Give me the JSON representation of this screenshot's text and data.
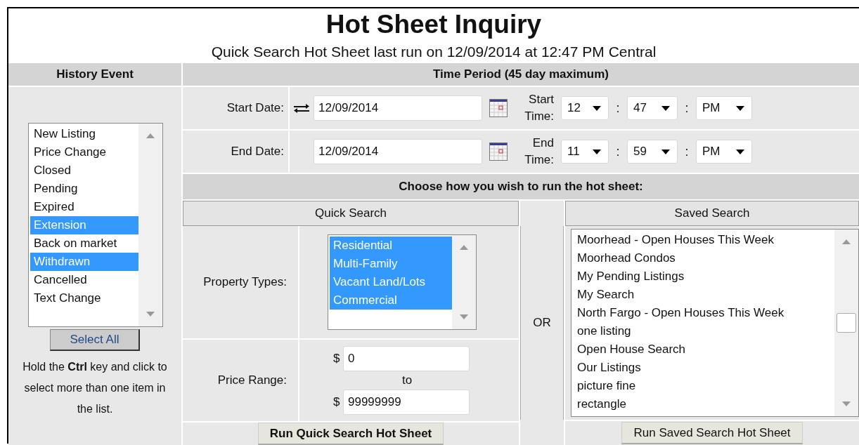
{
  "title": "Hot Sheet Inquiry",
  "subtitle": "Quick Search Hot Sheet last run on 12/09/2014 at 12:47 PM Central",
  "history": {
    "heading": "History Event",
    "items": [
      {
        "label": "New Listing",
        "selected": false
      },
      {
        "label": "Price Change",
        "selected": false
      },
      {
        "label": "Closed",
        "selected": false
      },
      {
        "label": "Pending",
        "selected": false
      },
      {
        "label": "Expired",
        "selected": false
      },
      {
        "label": "Extension",
        "selected": true
      },
      {
        "label": "Back on market",
        "selected": false
      },
      {
        "label": "Withdrawn",
        "selected": true
      },
      {
        "label": "Cancelled",
        "selected": false
      },
      {
        "label": "Text Change",
        "selected": false
      }
    ],
    "select_all": "Select All",
    "hint": "Hold the **Ctrl** key and click to select more than one item in the list."
  },
  "time_period": {
    "heading": "Time Period (45 day maximum)",
    "rows": [
      {
        "label": "Start Date:",
        "swap": true,
        "date": "12/09/2014",
        "time_label": "Start Time:",
        "hour": "12",
        "minute": "47",
        "ampm": "PM",
        "separator": ":"
      },
      {
        "label": "End Date:",
        "swap": false,
        "date": "12/09/2014",
        "time_label": "End Time:",
        "hour": "11",
        "minute": "59",
        "ampm": "PM",
        "separator": ":"
      }
    ]
  },
  "run": {
    "heading": "Choose how you wish to run the hot sheet:",
    "or": "OR",
    "quick": {
      "heading": "Quick Search",
      "property_label": "Property Types:",
      "property_types": [
        {
          "label": "Residential",
          "selected": true
        },
        {
          "label": "Multi-Family",
          "selected": true
        },
        {
          "label": "Vacant Land/Lots",
          "selected": true
        },
        {
          "label": "Commercial",
          "selected": true
        }
      ],
      "price_label": "Price Range:",
      "currency_min": "$",
      "min": "0",
      "to": "to",
      "currency_max": "$",
      "max": "99999999",
      "button": "Run Quick Search Hot Sheet"
    },
    "saved": {
      "heading": "Saved Search",
      "items": [
        {
          "label": "Moorhead - Open Houses This Week",
          "selected": false
        },
        {
          "label": "Moorhead Condos",
          "selected": false
        },
        {
          "label": "My Pending Listings",
          "selected": false
        },
        {
          "label": "My Search",
          "selected": false
        },
        {
          "label": "North Fargo - Open Houses This Week",
          "selected": false
        },
        {
          "label": "one listing",
          "selected": false
        },
        {
          "label": "Open House Search",
          "selected": false
        },
        {
          "label": "Our Listings",
          "selected": false
        },
        {
          "label": "picture fine",
          "selected": false
        },
        {
          "label": "rectangle",
          "selected": false
        }
      ],
      "button": "Run Saved Search Hot Sheet"
    }
  }
}
